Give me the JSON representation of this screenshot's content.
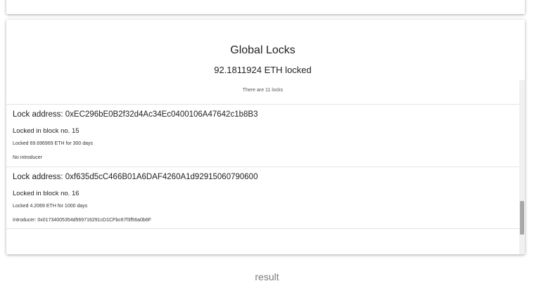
{
  "card": {
    "title": "Global Locks",
    "total_locked": "92.1811924 ETH locked",
    "count_text": "There are 11 locks"
  },
  "locks": [
    {
      "address": "Lock address: 0xEC296bE0B2f32d4Ac34Ec0400106A47642c1b8B3",
      "block": "Locked in block no. 15",
      "amount": "Locked 69.696969 ETH for 300 days",
      "introducer": "No introducer"
    },
    {
      "address": "Lock address: 0xf635d5cC466B01A6DAF4260A1d92915060790600",
      "block": "Locked in block no. 16",
      "amount": "Locked 4.2069 ETH for 1000 days",
      "introducer": "Introducer: 0x01734005354d569716291cD1CFbc67f3f56a0b6F"
    }
  ],
  "footer": {
    "label": "result"
  },
  "scroll": {
    "position_fraction": 0.95
  }
}
